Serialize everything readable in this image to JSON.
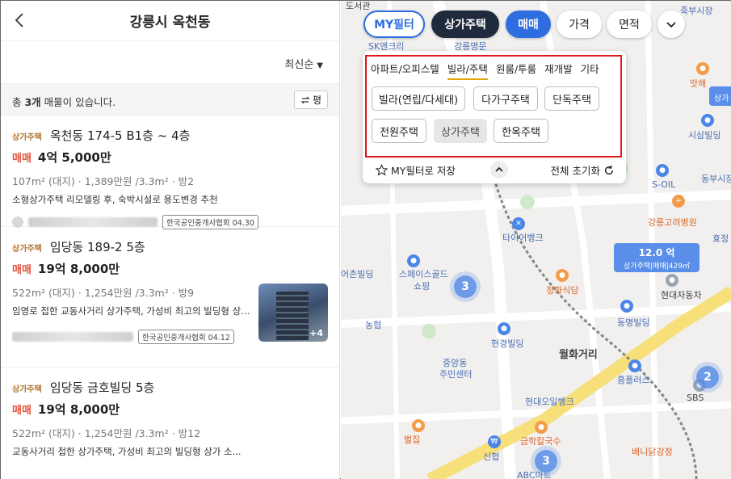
{
  "header": {
    "title": "강릉시 옥천동"
  },
  "sort": {
    "label": "최신순"
  },
  "count": {
    "prefix": "총 ",
    "num": "3개",
    "suffix": " 매물이 있습니다."
  },
  "unit_toggle": {
    "label": "평"
  },
  "listings": [
    {
      "tag": "상가주택",
      "address": "옥천동 174-5 B1층 ~ 4층",
      "deal": "매매",
      "price": "4억 5,000만",
      "spec": "107m² (대지) · 1,389만원 /3.3m² · 방2",
      "desc": "소형상가주택 리모델링 후, 숙박시설로 용도변경 추천",
      "assoc": "한국공인중개사협회 04.30"
    },
    {
      "tag": "상가주택",
      "address": "임당동 189-2 5층",
      "deal": "매매",
      "price": "19억 8,000만",
      "spec": "522m² (대지) · 1,254만원 /3.3m² · 방9",
      "desc": "임영로 접한 교동사거리 상가주택, 가성비 최고의 빌딩형 상가...",
      "assoc": "한국공인중개사협회 04.12",
      "photo_more": "+4"
    },
    {
      "tag": "상가주택",
      "address": "임당동 금호빌딩 5층",
      "deal": "매매",
      "price": "19억 8,000만",
      "spec": "522m² (대지) · 1,254만원 /3.3m² · 방12",
      "desc": "교동사거리 접한 상가주택, 가성비 최고의 빌딩형 상가 소..."
    }
  ],
  "chips": {
    "my": "MY필터",
    "type": "상가주택",
    "trade": "매매",
    "price": "가격",
    "area": "면적"
  },
  "dropdown": {
    "tabs": [
      "아파트/오피스텔",
      "빌라/주택",
      "원룸/투룸",
      "재개발",
      "기타"
    ],
    "active_tab": "빌라/주택",
    "pills": [
      "빌라(연립/다세대)",
      "다가구주택",
      "단독주택",
      "전원주택",
      "상가주택",
      "한옥주택"
    ],
    "selected_pill": "상가주택",
    "save_label": "MY필터로 저장",
    "reset_label": "전체 초기화"
  },
  "map": {
    "labels": [
      "도서관",
      "SK엔크리",
      "강릉명문",
      "죽부시장",
      "맛해",
      "시삼빌딩",
      "S-OIL",
      "동부시장",
      "강릉고려병원",
      "효정",
      "타이어뱅크",
      "어촌빌딩",
      "스페이스골드",
      "쇼핑",
      "정화식당",
      "현대자동차",
      "농협",
      "동명빌딩",
      "현경빌딩",
      "월화거리",
      "중앙동",
      "주민센터",
      "흠플러스",
      "SBS",
      "현대오일뱅크",
      "벌집",
      "금학칼국수",
      "신협",
      "ABC마트",
      "배니닭강정"
    ],
    "clusters": [
      "3",
      "2",
      "3"
    ],
    "pricebox": {
      "value": "12.0 억",
      "sub": "상가주택|매매|429㎡"
    },
    "edge_label": "상가"
  }
}
